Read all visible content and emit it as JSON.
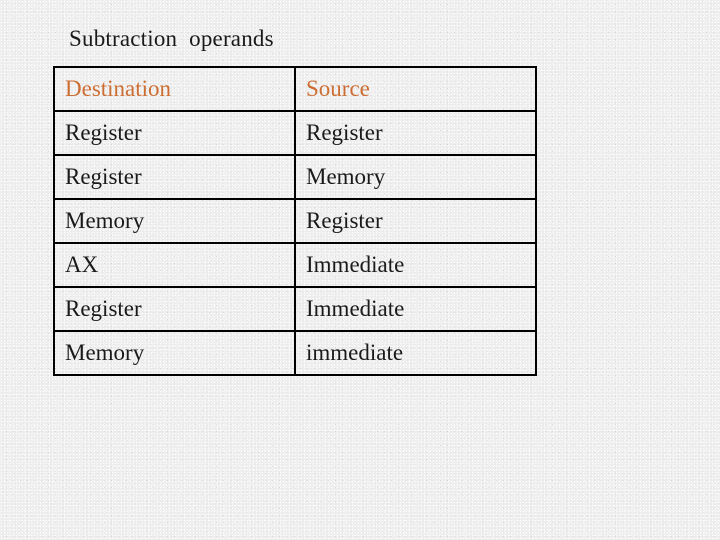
{
  "slide": {
    "title": "Subtraction  operands",
    "background_color": "#efefef",
    "text_color": "#1a1a1a",
    "header_color": "#cc6e33",
    "border_color": "#000000"
  },
  "table": {
    "columns": [
      {
        "label": "Destination"
      },
      {
        "label": "Source"
      }
    ],
    "rows": [
      {
        "destination": "Register",
        "source": "Register"
      },
      {
        "destination": "Register",
        "source": "Memory"
      },
      {
        "destination": "Memory",
        "source": "Register"
      },
      {
        "destination": "AX",
        "source": "Immediate"
      },
      {
        "destination": "Register",
        "source": "Immediate"
      },
      {
        "destination": "Memory",
        "source": "immediate"
      }
    ]
  }
}
